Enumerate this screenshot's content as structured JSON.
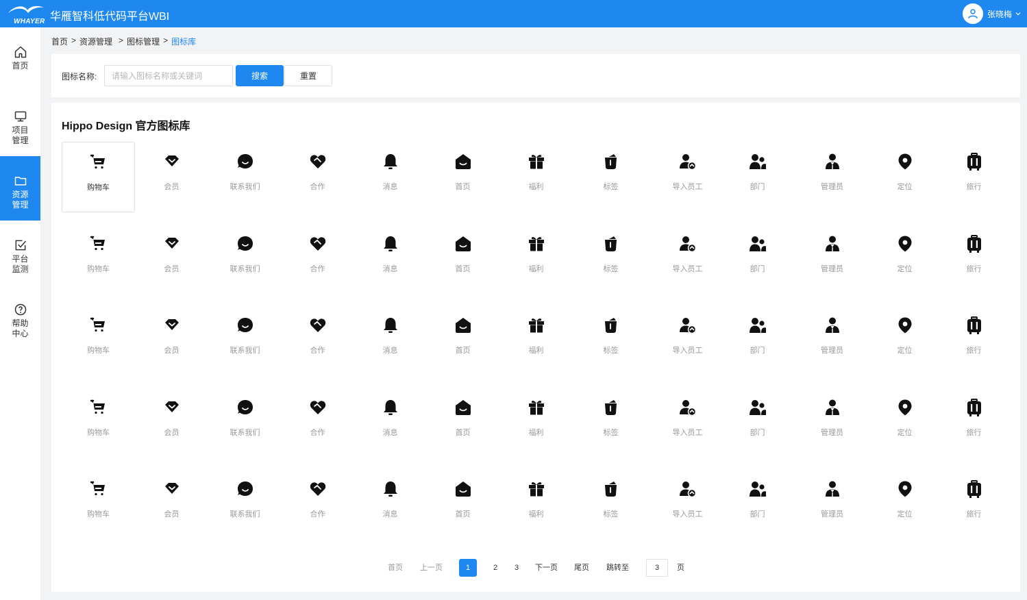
{
  "header": {
    "logo_text": "WHAYER",
    "app_title": "华雁智科低代码平台WBI",
    "user_name": "张晓梅"
  },
  "sidebar": {
    "items": [
      {
        "label": "首页",
        "icon": "home-icon",
        "active": false
      },
      {
        "label": "项目\n管理",
        "icon": "monitor-icon",
        "active": false
      },
      {
        "label": "资源\n管理",
        "icon": "folder-icon",
        "active": true
      },
      {
        "label": "平台\n监测",
        "icon": "checkbox-icon",
        "active": false
      },
      {
        "label": "帮助\n中心",
        "icon": "help-icon",
        "active": false
      }
    ]
  },
  "breadcrumb": {
    "items": [
      "首页",
      "资源管理",
      "图标管理",
      "图标库"
    ],
    "separator": ">"
  },
  "search": {
    "label": "图标名称:",
    "placeholder": "请输入图标名称或关键词",
    "value": "",
    "search_button": "搜索",
    "reset_button": "重置"
  },
  "library": {
    "title": "Hippo Design 官方图标库",
    "selected_index": 0,
    "icons": [
      {
        "name": "cart-icon",
        "label": "购物车"
      },
      {
        "name": "member-icon",
        "label": "会员"
      },
      {
        "name": "contact-icon",
        "label": "联系我们"
      },
      {
        "name": "cooperation-icon",
        "label": "合作"
      },
      {
        "name": "bell-icon",
        "label": "消息"
      },
      {
        "name": "home-filled-icon",
        "label": "首页"
      },
      {
        "name": "gift-icon",
        "label": "福利"
      },
      {
        "name": "tag-icon",
        "label": "标签"
      },
      {
        "name": "import-staff-icon",
        "label": "导入员工"
      },
      {
        "name": "department-icon",
        "label": "部门"
      },
      {
        "name": "admin-icon",
        "label": "管理员"
      },
      {
        "name": "location-icon",
        "label": "定位"
      },
      {
        "name": "luggage-icon",
        "label": "旅行"
      }
    ],
    "rows": 5
  },
  "pagination": {
    "first": "首页",
    "prev": "上一页",
    "pages": [
      "1",
      "2",
      "3"
    ],
    "current": "1",
    "next": "下一页",
    "last": "尾页",
    "jump_label": "跳转至",
    "jump_value": "3",
    "page_suffix": "页"
  },
  "colors": {
    "accent": "#1e88f0",
    "background": "#f2f3f5"
  }
}
